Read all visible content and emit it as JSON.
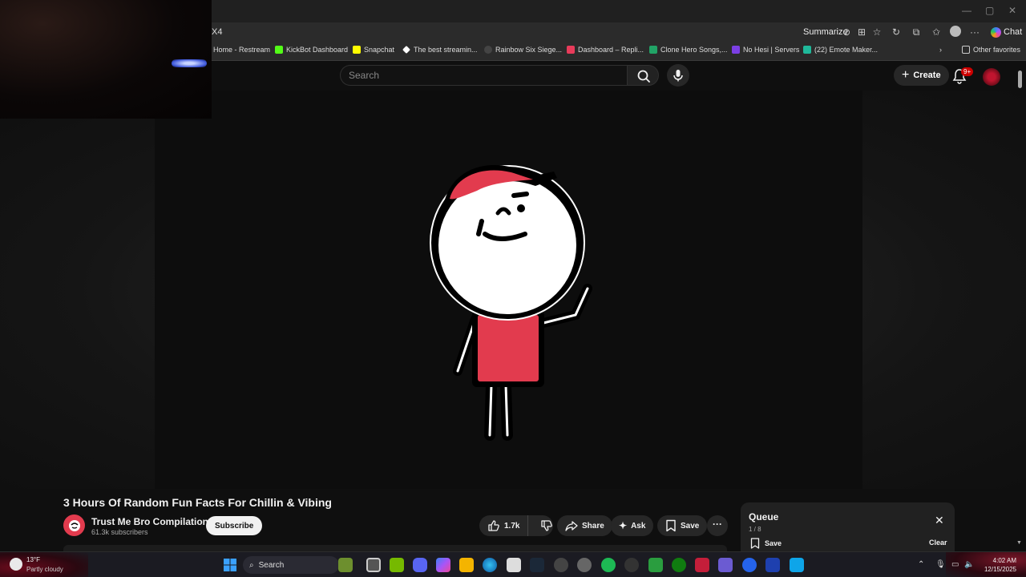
{
  "browser": {
    "url_fragment": "X4",
    "summarize_label": "Summarize",
    "chat_label": "Chat",
    "window_controls": [
      "—",
      "▢",
      "✕"
    ],
    "bookmarks": [
      {
        "label": "Home - Restream",
        "color": "#2e6bff"
      },
      {
        "label": "KickBot Dashboard",
        "color": "#53fc18"
      },
      {
        "label": "Snapchat",
        "color": "#fffc00"
      },
      {
        "label": "The best streamin...",
        "color": "#ffffff"
      },
      {
        "label": "Rainbow Six Siege...",
        "color": "#3a3a3a"
      },
      {
        "label": "Dashboard – Repli...",
        "color": "#e83b5a"
      },
      {
        "label": "Clone Hero Songs,...",
        "color": "#21a366"
      },
      {
        "label": "No Hesi | Servers",
        "color": "#5865f2"
      },
      {
        "label": "(22) Emote Maker...",
        "color": "#1fb89a"
      }
    ],
    "other_favorites": "Other favorites"
  },
  "youtube": {
    "search_placeholder": "Search",
    "create_label": "Create",
    "notification_badge": "9+",
    "video": {
      "title": "3 Hours Of Random Fun Facts For Chillin & Vibing",
      "channel_name": "Trust Me Bro Compilations",
      "subscribers": "61.3k subscribers",
      "subscribe_label": "Subscribe",
      "likes": "1.7k",
      "share_label": "Share",
      "ask_label": "Ask",
      "save_label": "Save",
      "more_label": "···"
    },
    "queue": {
      "title": "Queue",
      "count": "1 / 8",
      "save_label": "Save",
      "clear_label": "Clear"
    }
  },
  "taskbar": {
    "weather_temp": "13°F",
    "weather_desc": "Partly cloudy",
    "search_label": "Search",
    "time": "4:02 AM",
    "date": "12/15/2025"
  },
  "colors": {
    "accent_red": "#e23b4e",
    "background": "#0f0f0f",
    "pill": "#272727"
  }
}
